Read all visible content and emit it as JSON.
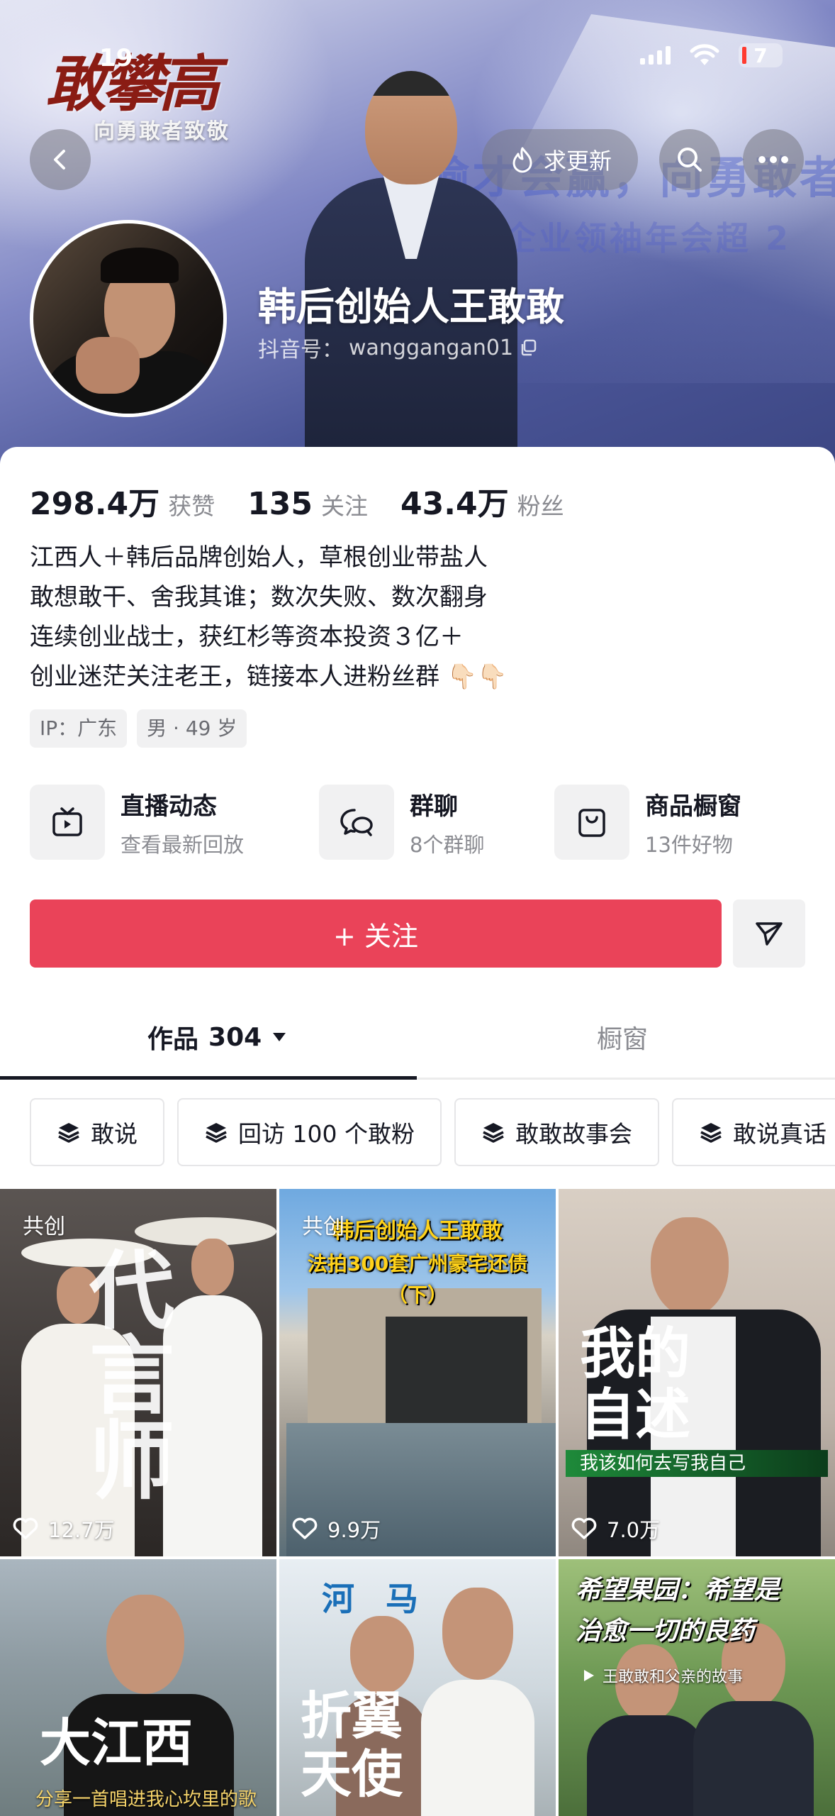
{
  "status_bar": {
    "time": "19",
    "battery": "7"
  },
  "header": {
    "logo_text": "敢攀高",
    "logo_subtitle": "向勇敢者致敬",
    "request_update_label": "求更新",
    "banner_text_1": "输才会赢，向勇敢者",
    "banner_text_2": "国企业领袖年会超 2",
    "icons": [
      "back-icon",
      "flame-icon",
      "search-icon",
      "more-icon"
    ]
  },
  "profile": {
    "name": "韩后创始人王敢敢",
    "handle_label": "抖音号：",
    "handle": "wanggangan01",
    "stats": {
      "likes_value": "298.4万",
      "likes_label": "获赞",
      "following_value": "135",
      "following_label": "关注",
      "followers_value": "43.4万",
      "followers_label": "粉丝"
    },
    "bio": [
      "江西人＋韩后品牌创始人，草根创业带盐人",
      "敢想敢干、舍我其谁；数次失败、数次翻身",
      "连续创业战士，获红杉等资本投资３亿＋",
      "创业迷茫关注老王，链接本人进粉丝群 👇🏻👇🏻"
    ],
    "tags": [
      "IP：广东",
      "男 · 49 岁"
    ]
  },
  "features": [
    {
      "title": "直播动态",
      "subtitle": "查看最新回放",
      "icon": "tv-icon"
    },
    {
      "title": "群聊",
      "subtitle": "8个群聊",
      "icon": "chat-icon"
    },
    {
      "title": "商品橱窗",
      "subtitle": "13件好物",
      "icon": "bag-icon"
    }
  ],
  "actions": {
    "follow_label": "+ 关注"
  },
  "tabs": {
    "works_label": "作品",
    "works_count": "304",
    "shop_label": "橱窗"
  },
  "collections": [
    "敢说",
    "回访 100 个敢粉",
    "敢敢故事会",
    "敢说真话"
  ],
  "videos": [
    {
      "badge": "共创",
      "likes": "12.7万",
      "title": "代言师"
    },
    {
      "badge": "共创",
      "likes": "9.9万",
      "title_lines": [
        "韩后创始人王敢敢",
        "法拍300套广州豪宅还债",
        "（下）"
      ]
    },
    {
      "badge": "",
      "likes": "7.0万",
      "title_lines": [
        "我的",
        "自述"
      ],
      "caption": "我该如何去写我自己"
    },
    {
      "badge": "",
      "likes": "",
      "title": "大江西",
      "caption": "分享一首唱进我心坎里的歌"
    },
    {
      "badge": "",
      "likes": "",
      "title_lines": [
        "折翼",
        "天使"
      ],
      "sign": "河 马"
    },
    {
      "badge": "",
      "likes": "",
      "title_lines": [
        "希望果园：希望是",
        "治愈一切的良药"
      ],
      "caption": "王敢敢和父亲的故事"
    }
  ],
  "colors": {
    "follow_button": "#ea4359",
    "text_primary": "#161823",
    "text_secondary": "#8a8b91"
  }
}
